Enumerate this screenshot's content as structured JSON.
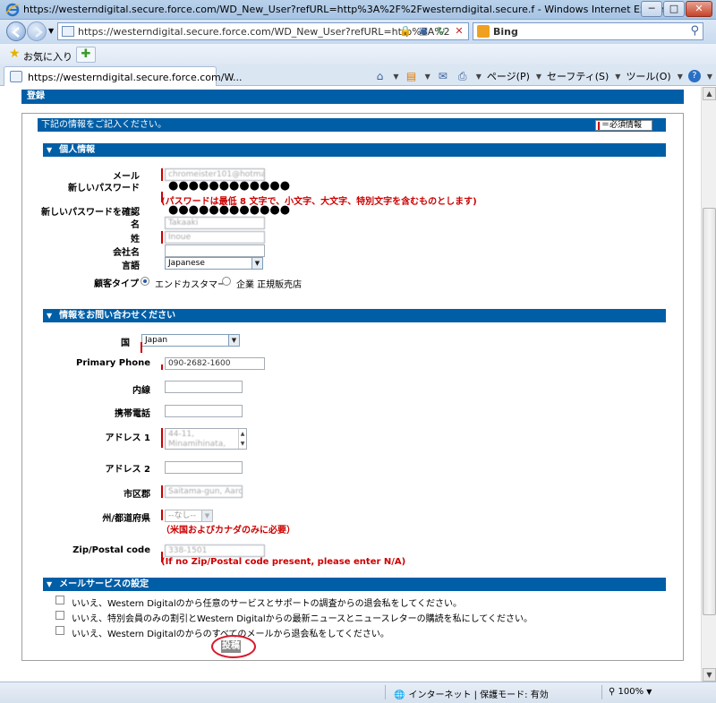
{
  "window": {
    "title": "https://westerndigital.secure.force.com/WD_New_User?refURL=http%3A%2F%2Fwesterndigital.secure.f - Windows Internet Explorer",
    "minimize": "─",
    "maximize": "□",
    "close": "✕"
  },
  "address": {
    "url": "https://westerndigital.secure.force.com/WD_New_User?refURL=http%3A%2"
  },
  "search": {
    "provider": "Bing"
  },
  "favorites": {
    "label": "お気に入り"
  },
  "tab": {
    "title": "https://westerndigital.secure.force.com/W..."
  },
  "commands": {
    "page": "ページ(P)",
    "safety": "セーフティ(S)",
    "tools": "ツール(O)"
  },
  "page": {
    "register_header": "登録",
    "instructions": "下記の情報をご記入ください。",
    "required_legend": "＝必須情報",
    "sections": {
      "personal": "個人情報",
      "inquiry": "情報をお問い合わせください",
      "mail": "メールサービスの設定"
    },
    "labels": {
      "email": "メール",
      "new_password": "新しいパスワード",
      "confirm_password": "新しいパスワードを確認",
      "first_name": "名",
      "last_name": "姓",
      "company": "会社名",
      "language": "言語",
      "customer_type": "顧客タイプ",
      "country": "国",
      "primary_phone": "Primary Phone",
      "extension": "内線",
      "mobile": "携帯電話",
      "address1": "アドレス 1",
      "address2": "アドレス 2",
      "city": "市区郡",
      "state": "州/都道府県",
      "zip": "Zip/Postal code"
    },
    "values": {
      "email": "chromeister101@hotma",
      "password_mask": "●●●●●●●●●●●●",
      "confirm_mask": "●●●●●●●●●●●●",
      "first_name": "Takaaki",
      "last_name": "Inoue",
      "company": "",
      "language": "Japanese",
      "country": "Japan",
      "primary_phone": "090-2682-1600",
      "extension": "",
      "mobile": "",
      "address1_line1": "44-11,",
      "address1_line2": "Minamihinata,",
      "address2": "",
      "city": "Saitama-gun, Aaro",
      "state": "--なし--",
      "zip": "338-1501"
    },
    "password_note": "(パスワードは最低 8 文字で、小文字、大文字、特別文字を含むものとします)",
    "state_note": "（米国およびカナダのみに必要）",
    "zip_note": "(If no Zip/Postal code present, please enter N/A)",
    "customer_types": [
      "エンドカスタマー",
      "企業 正規販売店"
    ],
    "mail_options": [
      "いいえ、Western Digitalのから任意のサービスとサポートの調査からの退会私をしてください。",
      "いいえ、特別会員のみの割引とWestern Digitalからの最新ニュースとニュースレターの購読を私にしてください。",
      "いいえ、Western Digitalのからのすべてのメールから退会私をしてください。"
    ],
    "submit": "投稿"
  },
  "status": {
    "zone": "インターネット | 保護モード: 有効",
    "zoom": "100%"
  },
  "colors": {
    "header_blue": "#005ea6",
    "required_red": "#cc0000",
    "highlight_ellipse": "#d8192c"
  }
}
